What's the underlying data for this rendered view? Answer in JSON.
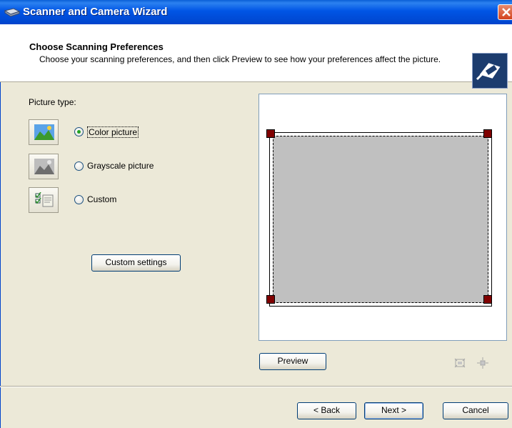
{
  "window": {
    "title": "Scanner and Camera Wizard"
  },
  "header": {
    "title": "Choose Scanning Preferences",
    "subtitle": "Choose your scanning preferences, and then click Preview to see how your preferences affect the picture."
  },
  "picture_type": {
    "label": "Picture type:",
    "options": [
      {
        "label": "Color picture",
        "selected": true
      },
      {
        "label": "Grayscale picture",
        "selected": false
      },
      {
        "label": "Custom",
        "selected": false
      }
    ]
  },
  "buttons": {
    "custom_settings": "Custom settings",
    "preview": "Preview",
    "back": "< Back",
    "next": "Next >",
    "cancel": "Cancel"
  },
  "icons": [
    "scanner-icon",
    "close-icon",
    "wizard-icon",
    "color-picture-icon",
    "grayscale-picture-icon",
    "custom-icon",
    "zoom-in-icon",
    "zoom-out-icon"
  ],
  "colors": {
    "title_bar": "#0055E5",
    "crop_handle": "#800000",
    "scan_area": "#C0C0C0",
    "radio_dot": "#21A121"
  }
}
